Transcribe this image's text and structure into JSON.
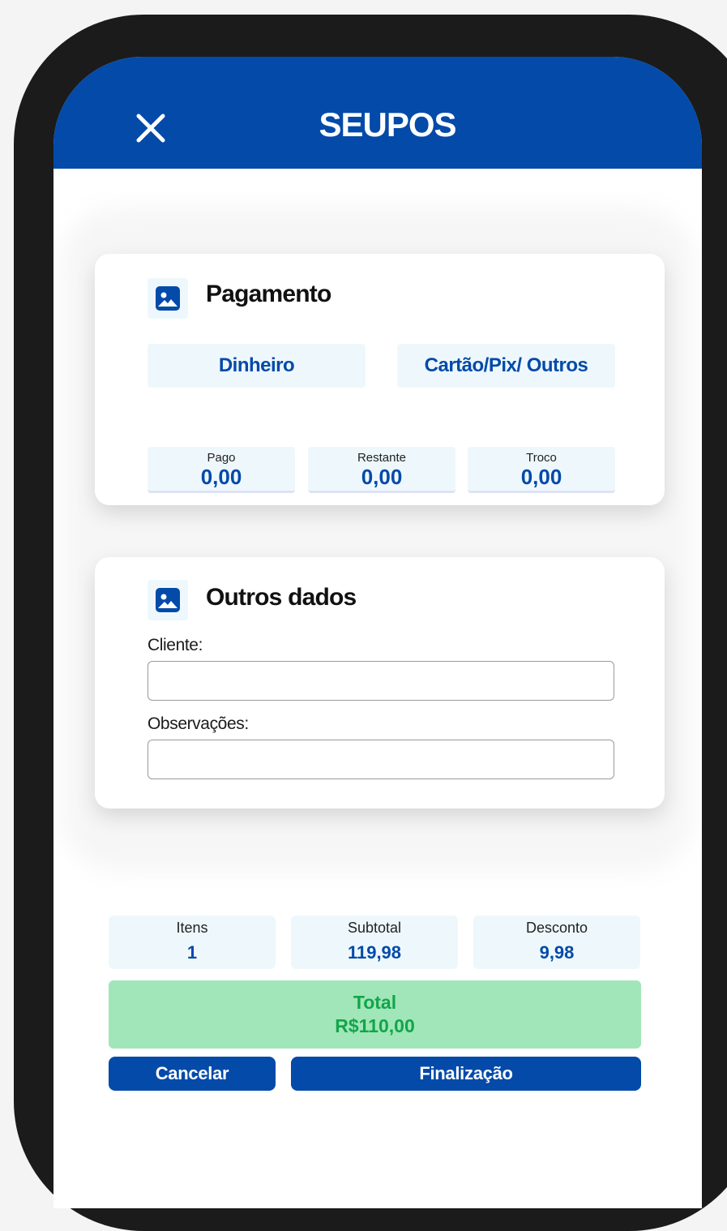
{
  "header": {
    "title": "SEUPOS",
    "close_icon": "close-icon",
    "background_color": "#034aa9"
  },
  "payment": {
    "title": "Pagamento",
    "icon": "image-icon",
    "options": [
      "Dinheiro",
      "Cartão/Pix/ Outros"
    ],
    "stats": [
      {
        "label": "Pago",
        "value": "0,00"
      },
      {
        "label": "Restante",
        "value": "0,00"
      },
      {
        "label": "Troco",
        "value": "0,00"
      }
    ]
  },
  "other_data": {
    "title": "Outros dados",
    "icon": "image-icon",
    "client_label": "Cliente:",
    "client_value": "",
    "notes_label": "Observações:",
    "notes_value": ""
  },
  "summary": [
    {
      "label": "Itens",
      "value": "1"
    },
    {
      "label": "Subtotal",
      "value": "119,98"
    },
    {
      "label": "Desconto",
      "value": "9,98"
    }
  ],
  "total": {
    "label": "Total",
    "value": "R$110,00",
    "background_color": "#a1e6b9",
    "text_color": "#12a54a"
  },
  "actions": {
    "cancel_label": "Cancelar",
    "finish_label": "Finalização"
  }
}
